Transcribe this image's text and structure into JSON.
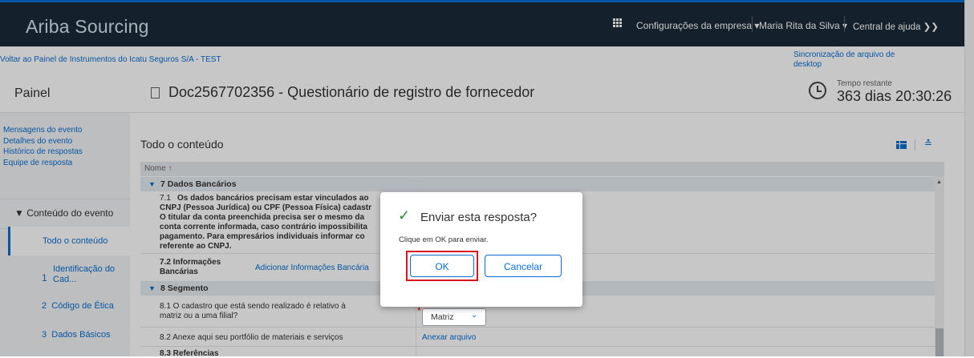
{
  "header": {
    "app_title": "Ariba Sourcing",
    "config_menu": "Configurações da empresa ▾",
    "user_menu": "Maria Rita da Silva ▾",
    "help": "Central de ajuda  ❯❯"
  },
  "subheader": {
    "back_link": "Voltar ao Painel de Instrumentos do Icatu Seguros S/A - TEST",
    "sync_link": "Sincronização de arquivo de desktop"
  },
  "title": {
    "painel": "Painel",
    "doc_title": "Doc2567702356 - Questionário de registro de fornecedor",
    "time_label": "Tempo restante",
    "time_value": "363 dias 20:30:26"
  },
  "nav": {
    "links": [
      "Mensagens do evento",
      "Detalhes do evento",
      "Histórico de respostas",
      "Equipe de resposta"
    ],
    "section": "▼ Conteúdo do evento",
    "selected": "Todo o conteúdo",
    "items": [
      {
        "num": "1",
        "label": "Identificação do Cad..."
      },
      {
        "num": "2",
        "label": "Código de Ética"
      },
      {
        "num": "3",
        "label": "Dados Básicos"
      }
    ]
  },
  "content": {
    "heading": "Todo o conteúdo",
    "col_nome": "Nome ↑",
    "group7": "7  Dados Bancários",
    "q71_num": "7.1",
    "q71_lines": [
      "Os dados bancários precisam estar vinculados ao",
      "CNPJ (Pessoa Jurídica) ou CPF (Pessoa Física) cadastr",
      "O titular da conta preenchida precisa ser o mesmo da",
      "conta corrente informada, caso contrário impossibilita",
      "pagamento. Para empresários individuais informar co",
      "referente ao CNPJ."
    ],
    "q72": "7.2  Informações",
    "q72b": "Bancárias",
    "q72_link": "Adicionar Informações Bancária",
    "group8": "8  Segmento",
    "q81_line1": "8.1  O cadastro que está sendo realizado é relativo à",
    "q81_line2": "matriz ou a uma filial?",
    "q81_value": "Matriz",
    "q82": "8.2  Anexe aqui seu portfólio de materiais e serviços",
    "q82_link": "Anexar arquivo",
    "q83": "8.3  Referências"
  },
  "dialog": {
    "title": "Enviar esta resposta?",
    "message": "Clique em OK para enviar.",
    "ok": "OK",
    "cancel": "Cancelar"
  }
}
